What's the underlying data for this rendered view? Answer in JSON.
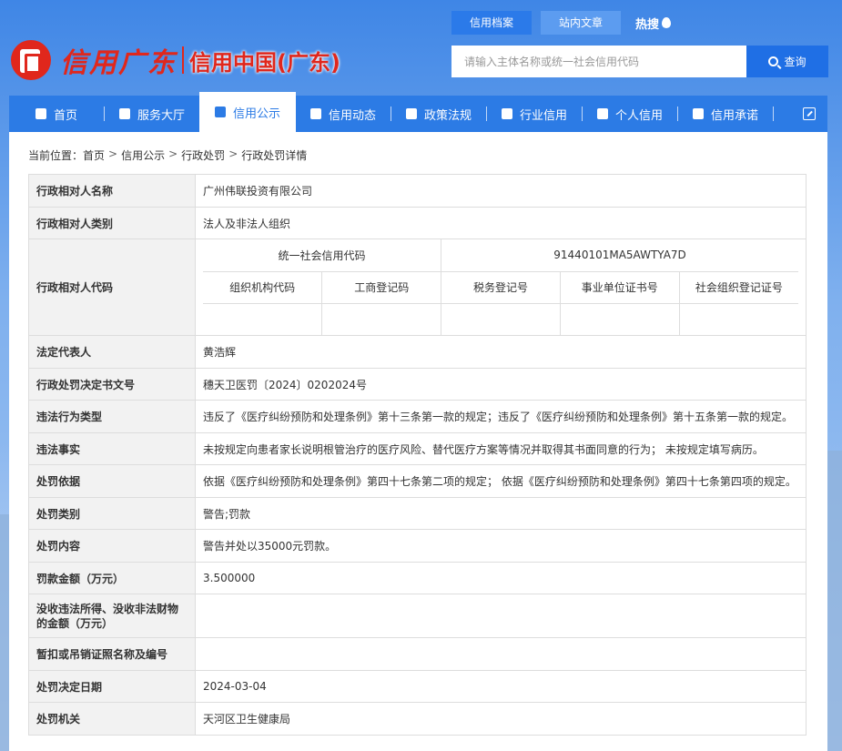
{
  "header": {
    "logo_script": "信用广东",
    "logo_text": "信用中国(广东)",
    "top_tabs": [
      "信用档案",
      "站内文章"
    ],
    "hot_label": "热搜",
    "search_placeholder": "请输入主体名称或统一社会信用代码",
    "search_button": "查询"
  },
  "nav": {
    "items": [
      {
        "label": "首页",
        "icon": "home-icon"
      },
      {
        "label": "服务大厅",
        "icon": "grid-icon"
      },
      {
        "label": "信用公示",
        "icon": "monitor-icon"
      },
      {
        "label": "信用动态",
        "icon": "news-icon"
      },
      {
        "label": "政策法规",
        "icon": "book-icon"
      },
      {
        "label": "行业信用",
        "icon": "building-icon"
      },
      {
        "label": "个人信用",
        "icon": "id-card-icon"
      },
      {
        "label": "信用承诺",
        "icon": "shield-icon"
      }
    ],
    "active_index": 2
  },
  "breadcrumb": {
    "prefix": "当前位置：",
    "items": [
      "首页",
      "信用公示",
      "行政处罚",
      "行政处罚详情"
    ],
    "separator": ">"
  },
  "detail": {
    "name_label": "行政相对人名称",
    "name_value": "广州伟联投资有限公司",
    "category_label": "行政相对人类别",
    "category_value": "法人及非法人组织",
    "code_label": "行政相对人代码",
    "uscc_label": "统一社会信用代码",
    "uscc_value": "91440101MA5AWTYA7D",
    "sub_codes": [
      "组织机构代码",
      "工商登记码",
      "税务登记号",
      "事业单位证书号",
      "社会组织登记证号"
    ],
    "sub_values": [
      "",
      "",
      "",
      "",
      ""
    ],
    "legal_rep_label": "法定代表人",
    "legal_rep_value": "黄浩辉",
    "doc_no_label": "行政处罚决定书文号",
    "doc_no_value": "穗天卫医罚〔2024〕0202024号",
    "violation_type_label": "违法行为类型",
    "violation_type_value": "违反了《医疗纠纷预防和处理条例》第十三条第一款的规定；违反了《医疗纠纷预防和处理条例》第十五条第一款的规定。",
    "facts_label": "违法事实",
    "facts_value": "未按规定向患者家长说明根管治疗的医疗风险、替代医疗方案等情况并取得其书面同意的行为； 未按规定填写病历。",
    "basis_label": "处罚依据",
    "basis_value": "依据《医疗纠纷预防和处理条例》第四十七条第二项的规定； 依据《医疗纠纷预防和处理条例》第四十七条第四项的规定。",
    "penalty_type_label": "处罚类别",
    "penalty_type_value": "警告;罚款",
    "penalty_content_label": "处罚内容",
    "penalty_content_value": "警告并处以35000元罚款。",
    "fine_label": "罚款金额（万元）",
    "fine_value": "3.500000",
    "confiscation_label": "没收违法所得、没收非法财物的金额（万元）",
    "confiscation_value": "",
    "license_label": "暂扣或吊销证照名称及编号",
    "license_value": "",
    "date_label": "处罚决定日期",
    "date_value": "2024-03-04",
    "authority_label": "处罚机关",
    "authority_value": "天河区卫生健康局"
  }
}
